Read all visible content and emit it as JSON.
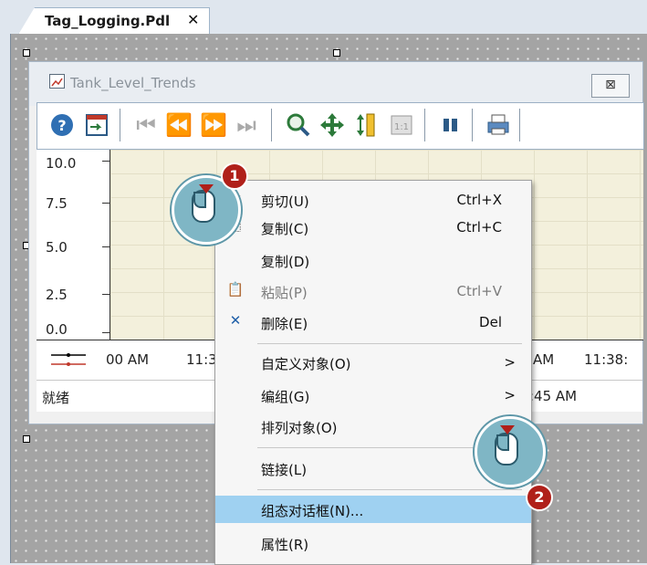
{
  "tab": {
    "label": "Tag_Logging.Pdl",
    "close": "✕"
  },
  "window": {
    "title": "Tank_Level_Trends",
    "close": "⊠"
  },
  "toolbar": {
    "buttons": [
      "help-icon",
      "config-icon",
      "first-icon",
      "prev-icon",
      "next-icon",
      "last-icon",
      "zoom-icon",
      "move-icon",
      "zoom-axis-icon",
      "original-view-icon",
      "stop-icon",
      "print-icon"
    ]
  },
  "trend": {
    "y_labels": [
      "10.0",
      "7.5",
      "5.0",
      "2.5",
      "0.0"
    ],
    "x_labels": [
      "00 AM",
      "11:3",
      "AM",
      "11:38:"
    ],
    "status": "就绪",
    "status_time": ":45 AM"
  },
  "context_menu": {
    "items": [
      {
        "label": "剪切(U)",
        "shortcut": "Ctrl+X",
        "icon": "cut-icon"
      },
      {
        "label": "复制(C)",
        "shortcut": "Ctrl+C",
        "icon": "copy-icon"
      },
      {
        "label": "复制(D)",
        "shortcut": ""
      },
      {
        "label": "粘贴(P)",
        "shortcut": "Ctrl+V",
        "icon": "paste-icon",
        "disabled": true
      },
      {
        "label": "删除(E)",
        "shortcut": "Del",
        "icon": "delete-icon"
      },
      {
        "label": "自定义对象(O)",
        "arrow": ">"
      },
      {
        "label": "编组(G)",
        "arrow": ">"
      },
      {
        "label": "排列对象(O)",
        "arrow": ">"
      },
      {
        "label": "链接(L)"
      },
      {
        "label": "组态对话框(N)...",
        "highlighted": true
      },
      {
        "label": "属性(R)"
      }
    ]
  },
  "callouts": [
    {
      "number": "1"
    },
    {
      "number": "2"
    }
  ],
  "colors": {
    "highlight": "#9fd1f1",
    "badge": "#b0201a",
    "bubble": "#7fb6c5"
  }
}
